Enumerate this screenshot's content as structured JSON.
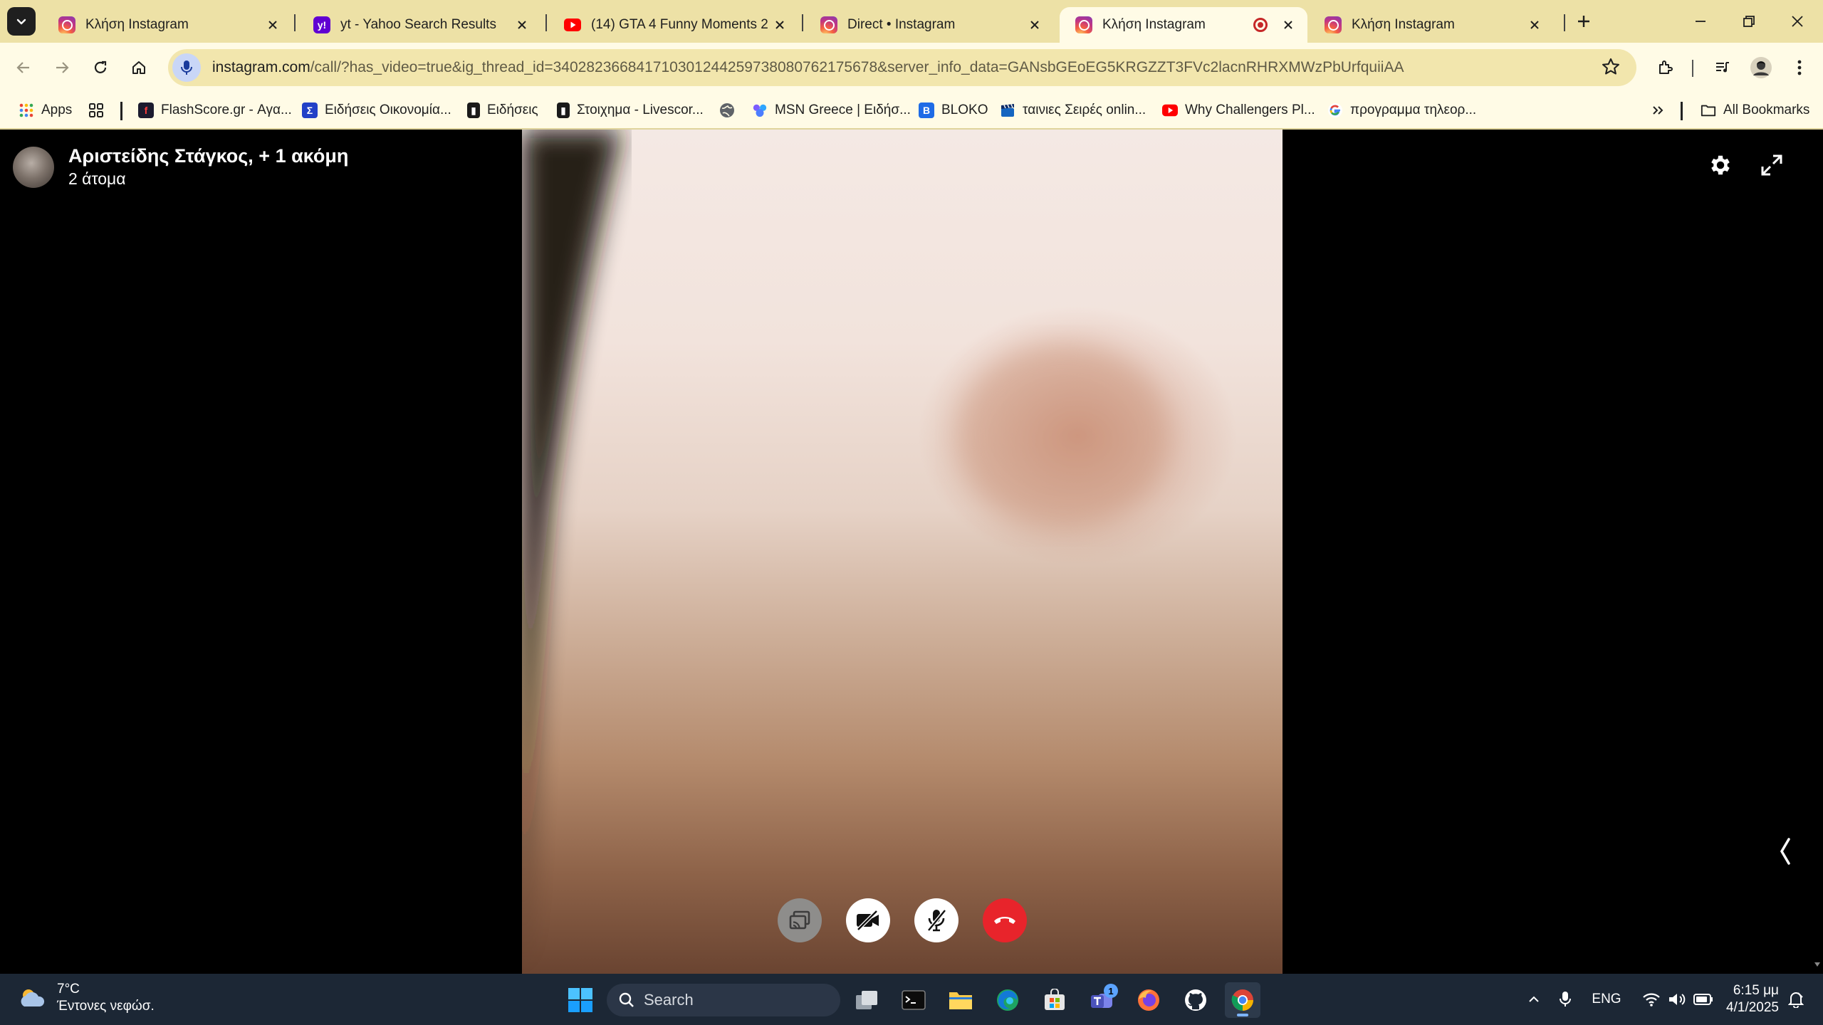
{
  "browser": {
    "tabs": [
      {
        "title": "Κλήση Instagram",
        "favicon": "instagram-icon",
        "active": false
      },
      {
        "title": "yt - Yahoo Search Results",
        "favicon": "yahoo-icon",
        "active": false
      },
      {
        "title": "(14) GTA 4 Funny Moments 2 -",
        "favicon": "youtube-icon",
        "active": false
      },
      {
        "title": "Direct • Instagram",
        "favicon": "instagram-icon",
        "active": false
      },
      {
        "title": "Κλήση Instagram",
        "favicon": "instagram-icon",
        "active": true,
        "recording": true
      },
      {
        "title": "Κλήση Instagram",
        "favicon": "instagram-icon",
        "active": false
      }
    ],
    "address": {
      "host": "instagram.com",
      "path": "/call/?has_video=true&ig_thread_id=340282366841710301244259738080762175678&server_info_data=GANsbGEoEG5KRGZZT3FVc2lacnRHRXMWzPbUrfquiiAA"
    },
    "bookmarks": [
      {
        "label": "Apps",
        "icon": "apps-grid-icon"
      },
      {
        "label": "FlashScore.gr - Αγα...",
        "icon": "flashscore-icon"
      },
      {
        "label": "Ειδήσεις Οικονομία...",
        "icon": "sigma-icon"
      },
      {
        "label": "Ειδήσεις",
        "icon": "news-icon"
      },
      {
        "label": "Στοιχημα - Livescor...",
        "icon": "livescore-icon"
      },
      {
        "label": "",
        "icon": "globe-icon"
      },
      {
        "label": "MSN Greece | Ειδήσ...",
        "icon": "msn-icon"
      },
      {
        "label": "BLOKO",
        "icon": "bloko-icon"
      },
      {
        "label": "ταινιες Σειρές onlin...",
        "icon": "clapper-icon"
      },
      {
        "label": "Why Challengers Pl...",
        "icon": "youtube-icon"
      },
      {
        "label": "προγραμμα τηλεορ...",
        "icon": "google-icon"
      }
    ],
    "all_bookmarks": "All Bookmarks"
  },
  "call": {
    "title": "Αριστείδης Στάγκος, + 1 ακόμη",
    "subtitle": "2 άτομα",
    "controls": [
      "screen-share-icon",
      "video-off-icon",
      "mic-off-icon",
      "end-call-icon"
    ]
  },
  "taskbar": {
    "weather": {
      "temp": "7°C",
      "desc": "Έντονες νεφώσ."
    },
    "search_placeholder": "Search",
    "teams_badge": "1",
    "language": "ENG",
    "time": "6:15 μμ",
    "date": "4/1/2025"
  },
  "colors": {
    "tabstrip": "#ede1a6",
    "toolbar": "#fffbe6",
    "end_call": "#e8242b",
    "taskbar": "#1c2735"
  }
}
